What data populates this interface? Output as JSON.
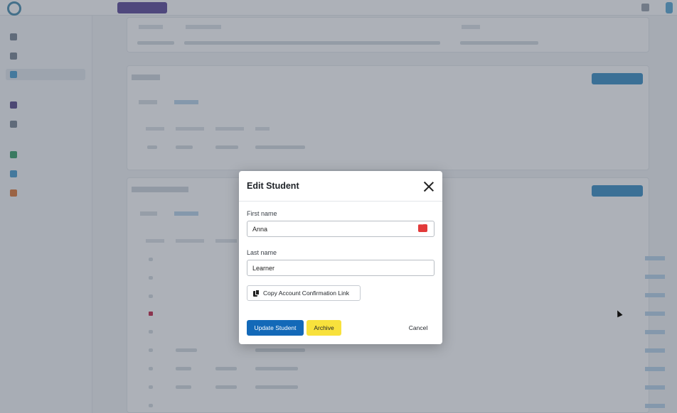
{
  "colors": {
    "primary": "#1369b8",
    "archive": "#f8e13c",
    "password_manager": "#e23a3a",
    "overlay": "rgba(60,70,85,0.42)"
  },
  "modal": {
    "title": "Edit Student",
    "first_name": {
      "label": "First name",
      "value": "Anna"
    },
    "last_name": {
      "label": "Last name",
      "value": "Learner"
    },
    "copy_link_label": "Copy Account Confirmation Link",
    "update_label": "Update Student",
    "archive_label": "Archive",
    "cancel_label": "Cancel"
  },
  "icons": {
    "close": "close-icon",
    "copy": "copy-icon",
    "password_manager": "password-manager-icon"
  }
}
